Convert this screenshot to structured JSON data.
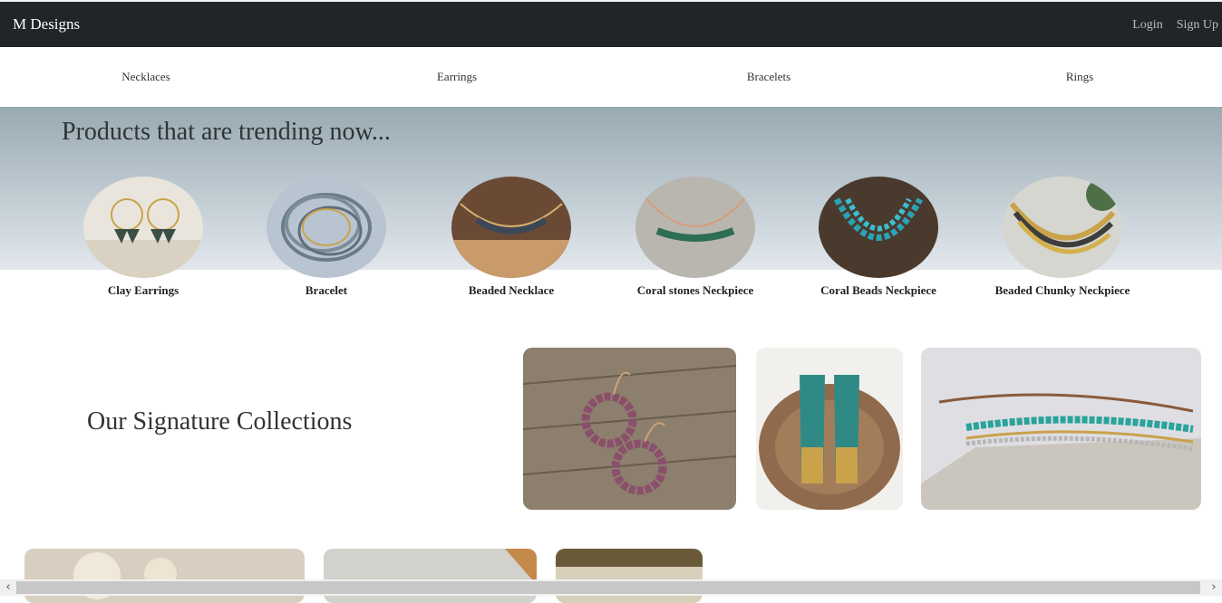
{
  "header": {
    "brand": "M Designs",
    "login": "Login",
    "signup": "Sign Up"
  },
  "categories": [
    "Necklaces",
    "Earrings",
    "Bracelets",
    "Rings"
  ],
  "trending": {
    "title": "Products that are trending now...",
    "products": [
      {
        "name": "Clay Earrings"
      },
      {
        "name": "Bracelet"
      },
      {
        "name": "Beaded Necklace"
      },
      {
        "name": "Coral stones Neckpiece"
      },
      {
        "name": "Coral Beads Neckpiece"
      },
      {
        "name": "Beaded Chunky Neckpiece"
      }
    ]
  },
  "signature": {
    "title": "Our Signature Collections"
  },
  "colors": {
    "navbar": "#212529",
    "gradient_top": "#98aab2",
    "gradient_bottom": "#e2e7ed"
  },
  "icons": {
    "scroll_left": "‹",
    "scroll_right": "›"
  }
}
